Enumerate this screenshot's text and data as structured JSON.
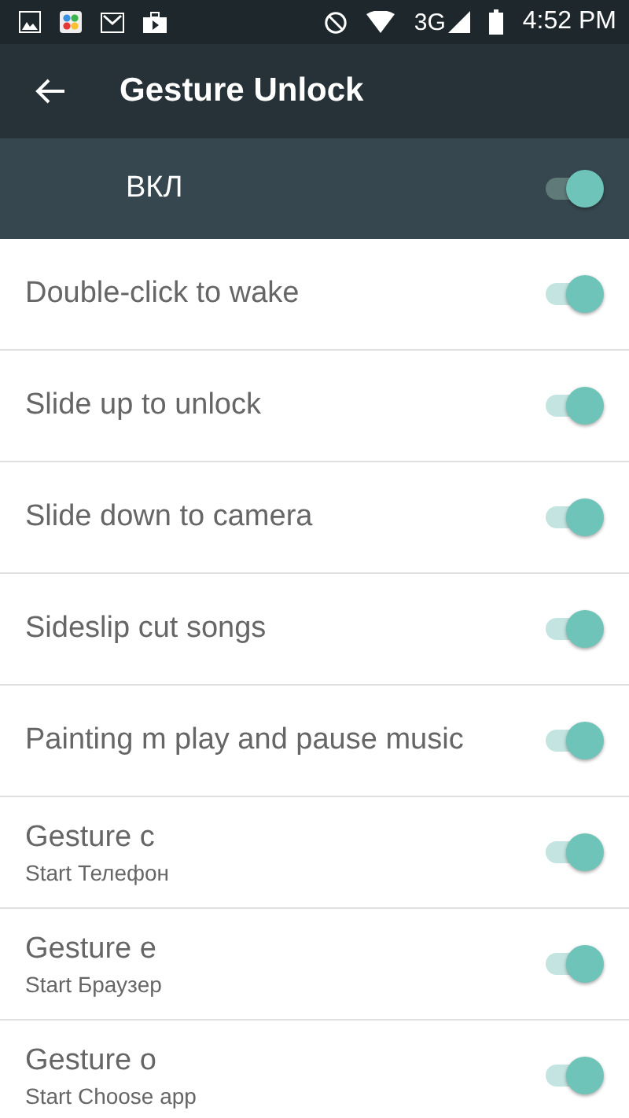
{
  "status_bar": {
    "network": "3G",
    "time": "4:52 PM"
  },
  "toolbar": {
    "title": "Gesture Unlock"
  },
  "master": {
    "label": "ВКЛ",
    "on": true
  },
  "settings": [
    {
      "title": "Double-click to wake",
      "on": true
    },
    {
      "title": "Slide up to unlock",
      "on": true
    },
    {
      "title": "Slide down to camera",
      "on": true
    },
    {
      "title": "Sideslip cut songs",
      "on": true
    },
    {
      "title": "Painting m play and pause music",
      "on": true
    },
    {
      "title": "Gesture c",
      "summary": "Start Телефон",
      "on": true
    },
    {
      "title": "Gesture e",
      "summary": "Start Браузер",
      "on": true
    },
    {
      "title": "Gesture o",
      "summary": "Start Choose app",
      "on": true
    }
  ]
}
